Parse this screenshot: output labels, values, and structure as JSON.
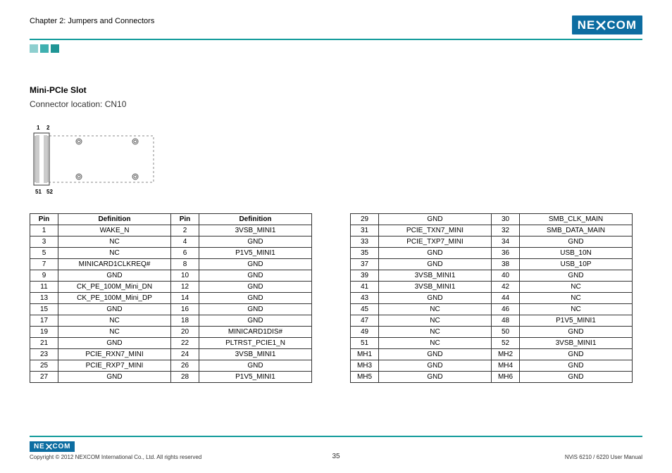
{
  "header": {
    "chapter": "Chapter 2: Jumpers and Connectors",
    "logo": "NEXCOM"
  },
  "section": {
    "title": "Mini-PCIe Slot",
    "connector": "Connector location: CN10"
  },
  "diagram_labels": {
    "top_left": "1",
    "top_right": "2",
    "bottom_left": "51",
    "bottom_right": "52"
  },
  "table_left": {
    "headers": [
      "Pin",
      "Definition",
      "Pin",
      "Definition"
    ],
    "rows": [
      [
        "1",
        "WAKE_N",
        "2",
        "3VSB_MINI1"
      ],
      [
        "3",
        "NC",
        "4",
        "GND"
      ],
      [
        "5",
        "NC",
        "6",
        "P1V5_MINI1"
      ],
      [
        "7",
        "MINICARD1CLKREQ#",
        "8",
        "GND"
      ],
      [
        "9",
        "GND",
        "10",
        "GND"
      ],
      [
        "11",
        "CK_PE_100M_Mini_DN",
        "12",
        "GND"
      ],
      [
        "13",
        "CK_PE_100M_Mini_DP",
        "14",
        "GND"
      ],
      [
        "15",
        "GND",
        "16",
        "GND"
      ],
      [
        "17",
        "NC",
        "18",
        "GND"
      ],
      [
        "19",
        "NC",
        "20",
        "MINICARD1DIS#"
      ],
      [
        "21",
        "GND",
        "22",
        "PLTRST_PCIE1_N"
      ],
      [
        "23",
        "PCIE_RXN7_MINI",
        "24",
        "3VSB_MINI1"
      ],
      [
        "25",
        "PCIE_RXP7_MINI",
        "26",
        "GND"
      ],
      [
        "27",
        "GND",
        "28",
        "P1V5_MINI1"
      ]
    ]
  },
  "table_right": {
    "rows": [
      [
        "29",
        "GND",
        "30",
        "SMB_CLK_MAIN"
      ],
      [
        "31",
        "PCIE_TXN7_MINI",
        "32",
        "SMB_DATA_MAIN"
      ],
      [
        "33",
        "PCIE_TXP7_MINI",
        "34",
        "GND"
      ],
      [
        "35",
        "GND",
        "36",
        "USB_10N"
      ],
      [
        "37",
        "GND",
        "38",
        "USB_10P"
      ],
      [
        "39",
        "3VSB_MINI1",
        "40",
        "GND"
      ],
      [
        "41",
        "3VSB_MINI1",
        "42",
        "NC"
      ],
      [
        "43",
        "GND",
        "44",
        "NC"
      ],
      [
        "45",
        "NC",
        "46",
        "NC"
      ],
      [
        "47",
        "NC",
        "48",
        "P1V5_MINI1"
      ],
      [
        "49",
        "NC",
        "50",
        "GND"
      ],
      [
        "51",
        "NC",
        "52",
        "3VSB_MINI1"
      ],
      [
        "MH1",
        "GND",
        "MH2",
        "GND"
      ],
      [
        "MH3",
        "GND",
        "MH4",
        "GND"
      ],
      [
        "MH5",
        "GND",
        "MH6",
        "GND"
      ]
    ]
  },
  "footer": {
    "logo": "NEXCOM",
    "copyright": "Copyright © 2012 NEXCOM International Co., Ltd. All rights reserved",
    "page": "35",
    "manual": "NViS 6210 / 6220 User Manual"
  }
}
